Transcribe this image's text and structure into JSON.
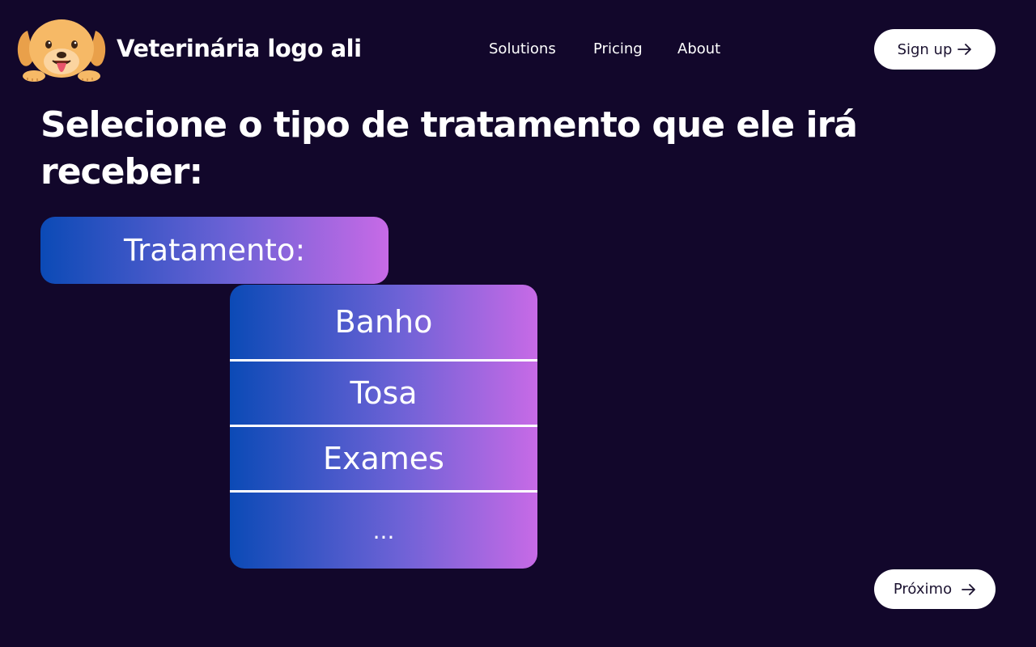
{
  "header": {
    "brand": "Veterinária logo ali",
    "logo_icon": "puppy-logo-icon",
    "nav": [
      {
        "label": "Solutions"
      },
      {
        "label": "Pricing"
      },
      {
        "label": "About"
      }
    ],
    "signup_label": "Sign up"
  },
  "main": {
    "heading": "Selecione o tipo de tratamento que ele irá receber:",
    "treatment_label": "Tratamento:",
    "options": [
      {
        "label": "Banho"
      },
      {
        "label": "Tosa"
      },
      {
        "label": "Exames"
      },
      {
        "label": "..."
      }
    ],
    "next_label": "Próximo"
  },
  "colors": {
    "background": "#12072b",
    "gradient_start": "#0b4ab6",
    "gradient_end": "#c76ae6",
    "button_bg": "#ffffff"
  }
}
